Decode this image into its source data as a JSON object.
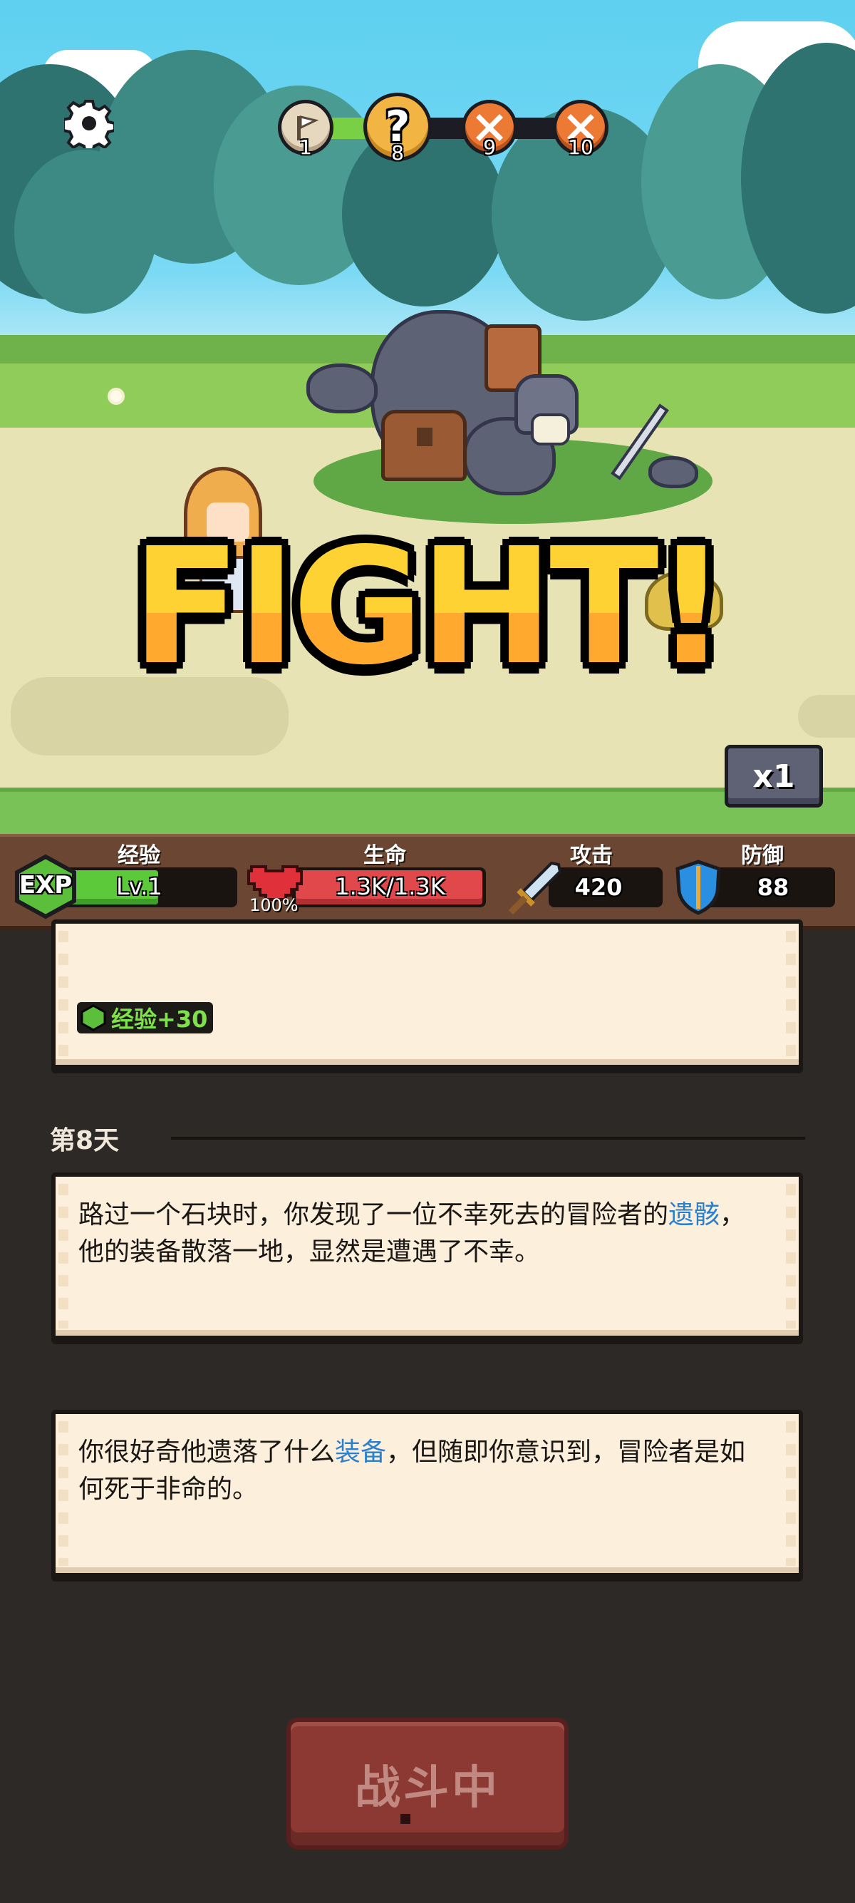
{
  "hud": {
    "stage_nodes": [
      {
        "number": "1",
        "type": "flag",
        "state": "cleared"
      },
      {
        "number": "8",
        "type": "question",
        "state": "current"
      },
      {
        "number": "9",
        "type": "battle",
        "state": "upcoming"
      },
      {
        "number": "10",
        "type": "battle",
        "state": "upcoming"
      }
    ],
    "settings_icon": "gear-icon"
  },
  "scene": {
    "banner": "FIGHT!",
    "speed_button": "x1"
  },
  "stats": {
    "exp": {
      "title": "经验",
      "level": "Lv.1",
      "badge": "EXP",
      "fill": 0.55,
      "color": "#5bc93a"
    },
    "hp": {
      "title": "生命",
      "value": "1.3K/1.3K",
      "percent": "100%",
      "fill": 1.0,
      "color": "#e0484c"
    },
    "attack": {
      "title": "攻击",
      "value": "420",
      "icon": "sword-icon"
    },
    "defense": {
      "title": "防御",
      "value": "88",
      "icon": "shield-icon"
    }
  },
  "log": {
    "reward_card": {
      "reward_text": "经验+30",
      "badge": "EXP"
    },
    "day_label": "第8天",
    "entries": [
      {
        "parts": [
          {
            "text": "路过一个石块时，你发现了一位不幸死去的冒险者的",
            "highlight": false
          },
          {
            "text": "遗骸",
            "highlight": true
          },
          {
            "text": "，他的装备散落一地，显然是遭遇了不幸。",
            "highlight": false
          }
        ]
      },
      {
        "parts": [
          {
            "text": "你很好奇他遗落了什么",
            "highlight": false
          },
          {
            "text": "装备",
            "highlight": true
          },
          {
            "text": "，但随即你意识到，冒险者是如何死于非命的。",
            "highlight": false
          }
        ]
      }
    ]
  },
  "action_button": {
    "label": "战斗中",
    "state": "disabled"
  },
  "colors": {
    "highlight": "#2b7fcf",
    "panel_bg": "#2d2926",
    "card_bg": "#fcefdc",
    "banner_yellow": "#ffd233"
  }
}
